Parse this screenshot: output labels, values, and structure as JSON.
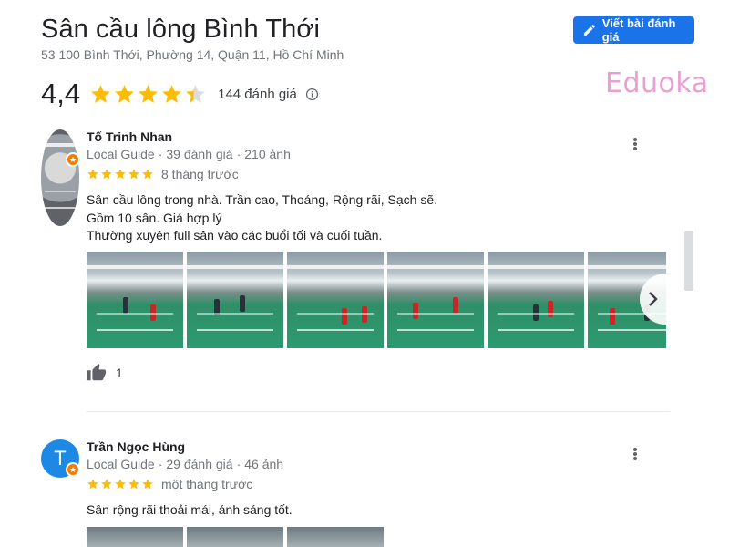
{
  "place": {
    "title": "Sân cầu lông Bình Thới",
    "address": "53 100 Bình Thới, Phường 14, Quận 11, Hồ Chí Minh"
  },
  "write_review": {
    "label": "Viết bài đánh giá",
    "icon": "pencil-icon"
  },
  "watermark": "Eduoka",
  "summary": {
    "rating": "4,4",
    "rating_value": 4.4,
    "max": 5,
    "count_label": "144 đánh giá"
  },
  "reviews": [
    {
      "name": "Tố Trinh Nhan",
      "guide": "Local Guide",
      "reviews": "39 đánh giá",
      "photos": "210 ảnh",
      "stars": 5,
      "when": "8 tháng trước",
      "lines": [
        "Sân cầu lông trong nhà. Trần cao, Thoáng, Rộng rãi, Sạch sẽ.",
        "Gồm 10 sân. Giá hợp lý",
        "Thường xuyên full sân vào các buổi tối và cuối tuần."
      ],
      "likes": "1"
    },
    {
      "name": "Trần Ngọc Hùng",
      "initial": "T",
      "guide": "Local Guide",
      "reviews": "29 đánh giá",
      "photos": "46 ảnh",
      "stars": 5,
      "when": "một tháng trước",
      "lines": [
        "Sân rộng rãi thoải mái, ánh sáng tốt."
      ]
    }
  ],
  "colors": {
    "accent": "#1a73e8",
    "star": "#fbbc04",
    "badge": "#f57c00",
    "watermark": "#e8a0d2"
  }
}
